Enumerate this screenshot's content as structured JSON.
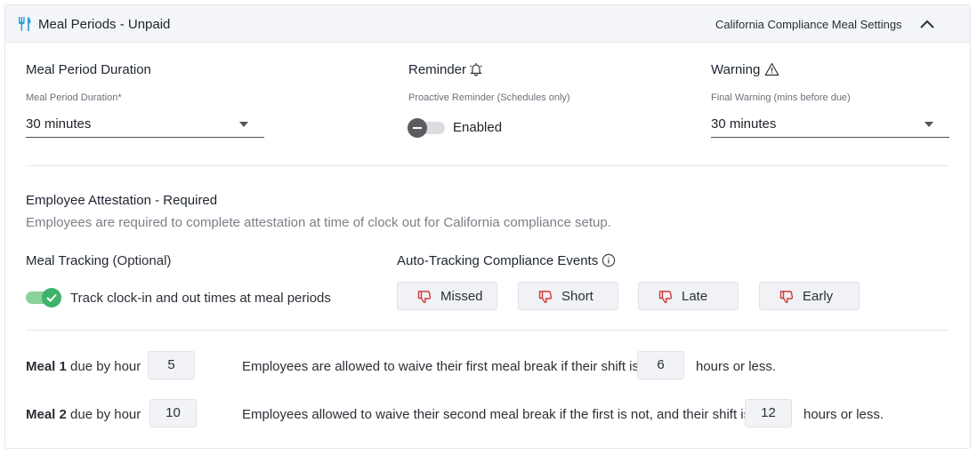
{
  "header": {
    "title": "Meal Periods - Unpaid",
    "right_label": "California Compliance Meal Settings"
  },
  "duration": {
    "title": "Meal Period Duration",
    "field_label": "Meal Period Duration*",
    "value": "30 minutes"
  },
  "reminder": {
    "title": "Reminder",
    "field_label": "Proactive Reminder (Schedules only)",
    "toggle_label": "Enabled"
  },
  "warning": {
    "title": "Warning",
    "field_label": "Final Warning (mins before due)",
    "value": "30 minutes"
  },
  "attestation": {
    "title": "Employee Attestation - Required",
    "description": "Employees are required to complete attestation at time of clock out for California compliance setup."
  },
  "meal_tracking": {
    "title": "Meal Tracking",
    "title_suffix": "(Optional)",
    "toggle_label": "Track clock-in and out times at meal periods"
  },
  "auto_tracking": {
    "title": "Auto-Tracking Compliance Events",
    "events": [
      "Missed",
      "Short",
      "Late",
      "Early"
    ]
  },
  "meals": [
    {
      "name": "Meal 1",
      "due_label": "due by hour",
      "due_hour": "5",
      "waive_text": "Employees are allowed to waive their first meal break if their shift is",
      "waive_hours": "6",
      "suffix": "hours or less."
    },
    {
      "name": "Meal 2",
      "due_label": "due by hour",
      "due_hour": "10",
      "waive_text": "Employees allowed to waive their second meal break if the first is not, and their shift is",
      "waive_hours": "12",
      "suffix": "hours or less."
    }
  ],
  "colors": {
    "toggle_on": "#3db36b",
    "thumb_down": "#d23a3a",
    "header_icon": "#2a9fd6"
  }
}
